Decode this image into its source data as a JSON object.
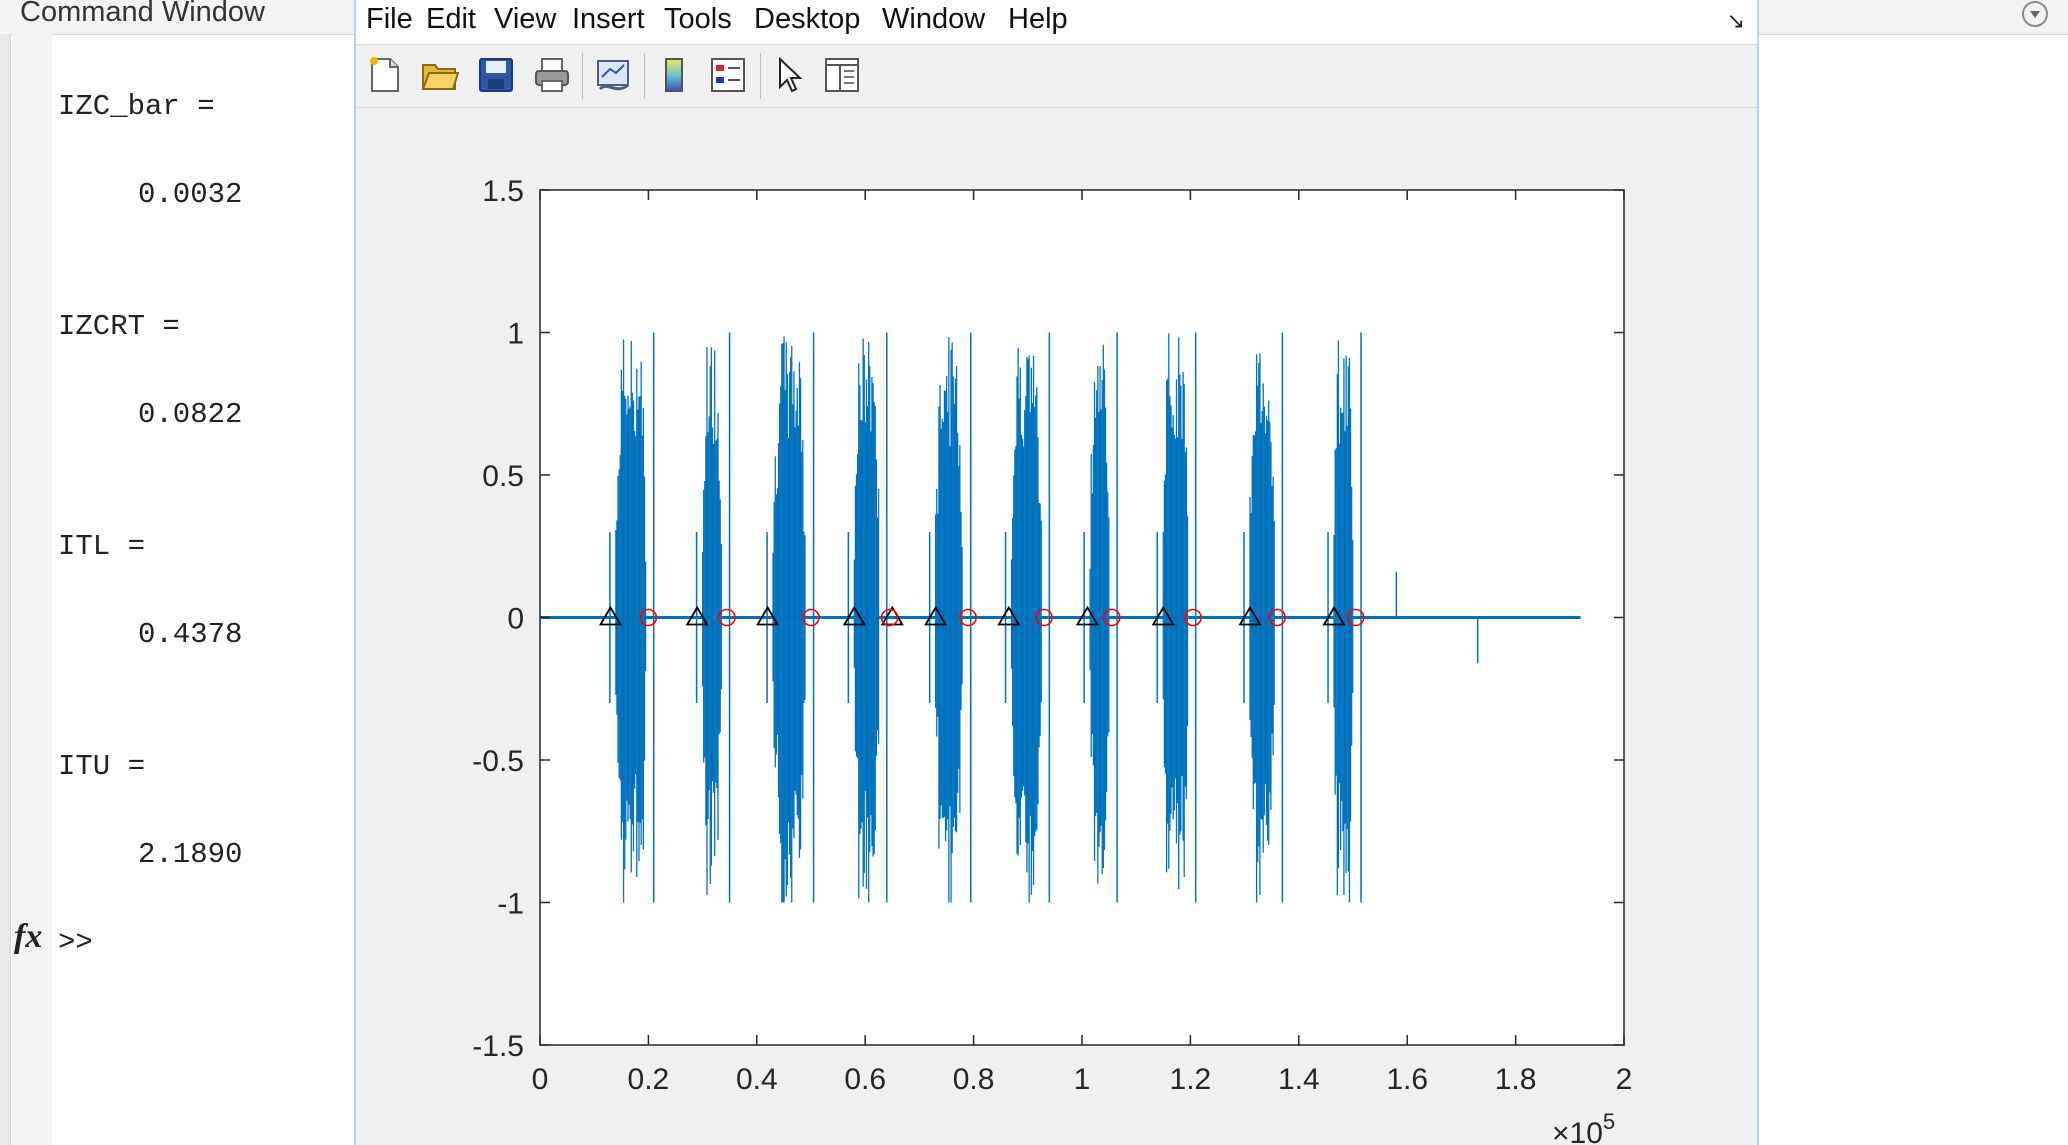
{
  "command_window": {
    "title": "Command Window",
    "lines": [
      {
        "text": "IZC_bar ="
      },
      {
        "text": "0.0032"
      },
      {
        "text": "IZCRT ="
      },
      {
        "text": "0.0822"
      },
      {
        "text": "ITL ="
      },
      {
        "text": "0.4378"
      },
      {
        "text": "ITU ="
      },
      {
        "text": "2.1890"
      }
    ],
    "fx_symbol": "fx",
    "prompt": ">>"
  },
  "figure": {
    "menu": [
      "File",
      "Edit",
      "View",
      "Insert",
      "Tools",
      "Desktop",
      "Window",
      "Help"
    ],
    "dock_icon": "↘",
    "toolbar_icons": [
      "new-figure-icon",
      "open-file-icon",
      "save-icon",
      "print-icon",
      "link-plot-icon",
      "colorbar-icon",
      "legend-icon",
      "pointer-icon",
      "property-editor-icon"
    ]
  },
  "chart_data": {
    "type": "line",
    "title": "",
    "xlabel": "",
    "ylabel": "",
    "x_exponent_label": "×10",
    "x_exponent": "5",
    "xlim": [
      0,
      2
    ],
    "ylim": [
      -1.5,
      1.5
    ],
    "xticks": [
      "0",
      "0.2",
      "0.4",
      "0.6",
      "0.8",
      "1",
      "1.2",
      "1.4",
      "1.6",
      "1.8",
      "2"
    ],
    "yticks": [
      "1.5",
      "1",
      "0.5",
      "0",
      "-0.5",
      "-1",
      "-1.5"
    ],
    "signal_end": 1.92,
    "series": [
      {
        "marker": "line",
        "color": "#0072BD",
        "bursts": [
          {
            "start": 0.14,
            "end": 0.195
          },
          {
            "start": 0.3,
            "end": 0.335
          },
          {
            "start": 0.43,
            "end": 0.49
          },
          {
            "start": 0.58,
            "end": 0.625
          },
          {
            "start": 0.73,
            "end": 0.78
          },
          {
            "start": 0.87,
            "end": 0.925
          },
          {
            "start": 1.015,
            "end": 1.05
          },
          {
            "start": 1.15,
            "end": 1.195
          },
          {
            "start": 1.31,
            "end": 1.355
          },
          {
            "start": 1.465,
            "end": 1.5
          }
        ]
      },
      {
        "marker": "triangle",
        "color": "#000000",
        "x": [
          0.13,
          0.29,
          0.42,
          0.58,
          0.65,
          0.73,
          0.865,
          1.01,
          1.15,
          1.31,
          1.465
        ],
        "y": [
          0,
          0,
          0,
          0,
          0,
          0,
          0,
          0,
          0,
          0,
          0
        ]
      },
      {
        "marker": "circle",
        "color": "#FF0000",
        "x": [
          0.2,
          0.345,
          0.5,
          0.645,
          0.79,
          0.93,
          1.055,
          1.205,
          1.36,
          1.505
        ],
        "y": [
          0,
          0,
          0,
          0,
          0,
          0,
          0,
          0,
          0,
          0
        ]
      }
    ],
    "grid": false
  }
}
